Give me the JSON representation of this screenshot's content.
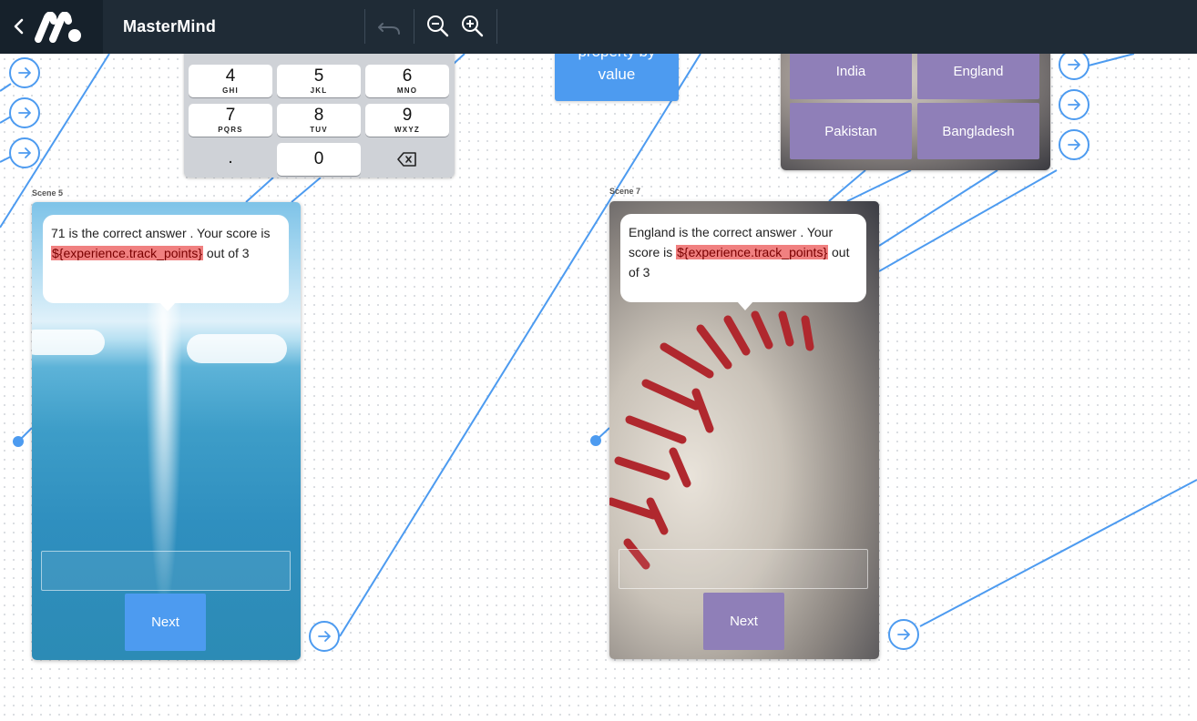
{
  "topbar": {
    "app_title": "MasterMind",
    "back_icon": "chevron-left-icon",
    "logo": "mastermind-logo",
    "undo_icon": "undo-icon",
    "zoom_out_icon": "zoom-out-icon",
    "zoom_in_icon": "zoom-in-icon"
  },
  "keypad": {
    "keys": [
      {
        "digit": "4",
        "letters": "GHI"
      },
      {
        "digit": "5",
        "letters": "JKL"
      },
      {
        "digit": "6",
        "letters": "MNO"
      },
      {
        "digit": "7",
        "letters": "PQRS"
      },
      {
        "digit": "8",
        "letters": "TUV"
      },
      {
        "digit": "9",
        "letters": "WXYZ"
      },
      {
        "digit": ".",
        "letters": ""
      },
      {
        "digit": "0",
        "letters": ""
      }
    ],
    "backspace_icon": "backspace-icon"
  },
  "blue_node": {
    "line1": "property by",
    "line2": "value"
  },
  "options_card": {
    "options": [
      "India",
      "England",
      "Pakistan",
      "Bangladesh"
    ]
  },
  "scene5": {
    "label": "Scene 5",
    "message_before": "71 is the correct answer . Your score is",
    "variable": "${experience.track_points}",
    "message_after": "out of 3",
    "next_label": "Next"
  },
  "scene7": {
    "label": "Scene 7",
    "message_before": "England is the correct answer . Your score is",
    "variable": "${experience.track_points}",
    "message_after": "out of 3",
    "next_label": "Next"
  },
  "colors": {
    "topbar": "#1f2b36",
    "wire": "#4d9bf0",
    "option_purple": "#8f7fb8",
    "next_blue": "#4d9bf0",
    "variable_highlight": "#f08080"
  }
}
